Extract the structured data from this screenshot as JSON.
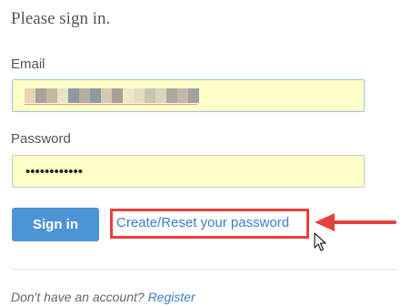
{
  "heading": "Please sign in.",
  "form": {
    "email_label": "Email",
    "password_label": "Password",
    "password_value": "••••••••••••",
    "signin_label": "Sign in",
    "reset_link": "Create/Reset your password"
  },
  "footer": {
    "prompt": "Don't have an account?",
    "register_link": "Register"
  },
  "colors": {
    "input_autofill": "#ffffc8",
    "button_blue": "#4d94d6",
    "link_blue": "#3a7fc4",
    "annotation_red": "#e8413d"
  },
  "icons": {
    "pointer": "mouse-cursor-icon",
    "annotation": "red-arrow-icon"
  }
}
